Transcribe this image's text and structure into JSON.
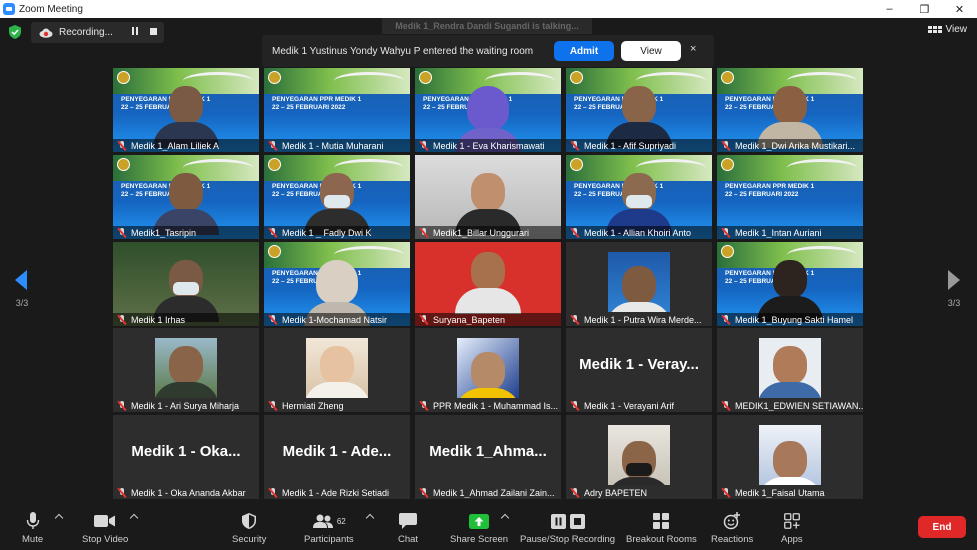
{
  "window": {
    "title": "Zoom Meeting",
    "minimize": "–",
    "maximize": "❐",
    "close": "✕"
  },
  "topbar": {
    "recording_label": "Recording...",
    "talking_banner": "Medik 1_Rendra Dandi Sugandi is talking...",
    "view_label": "View"
  },
  "notification": {
    "message": "Medik 1   Yustinus Yondy Wahyu P entered the waiting room",
    "admit_label": "Admit",
    "view_label": "View",
    "close_label": "×"
  },
  "pager": {
    "left_page": "3/3",
    "right_page": "3/3"
  },
  "banner": {
    "line1": "PENYEGARAN PPR MEDIK 1",
    "line2": "22 – 25 FEBRUARI 2022"
  },
  "participants": [
    {
      "name": "Medik 1_Alam Liliek A"
    },
    {
      "name": "Medik 1 - Mutia Muharani"
    },
    {
      "name": "Medik 1 - Eva Kharismawati"
    },
    {
      "name": "Medik 1 - Afif Supriyadi"
    },
    {
      "name": "Medik 1_Dwi Arika Mustikari..."
    },
    {
      "name": "Medik1_Tasripin"
    },
    {
      "name": "Medik 1 _ Fadly Dwi K"
    },
    {
      "name": "Medik1_Billar Unggurari"
    },
    {
      "name": "Medik 1 - Allian Khoiri Anto"
    },
    {
      "name": "Medik 1_Intan Auriani"
    },
    {
      "name": "Medik 1 Irhas"
    },
    {
      "name": "Medik 1-Mochamad Natsir"
    },
    {
      "name": "Suryana_Bapeten"
    },
    {
      "name": "Medik 1 - Putra Wira Merde..."
    },
    {
      "name": "Medik 1_Buyung Sakti Hamel"
    },
    {
      "name": "Medik 1 - Ari Surya Miharja"
    },
    {
      "name": "Hermiati Zheng"
    },
    {
      "name": "PPR Medik 1 - Muhammad Is..."
    },
    {
      "name": "Medik 1 - Verayani Arif",
      "big": "Medik 1 - Veray..."
    },
    {
      "name": "MEDIK1_EDWIEN SETIAWAN..."
    },
    {
      "name": "Medik 1 - Oka Ananda Akbar",
      "big": "Medik 1 - Oka..."
    },
    {
      "name": "Medik 1 - Ade Rizki Setiadi",
      "big": "Medik 1 - Ade..."
    },
    {
      "name": "Medik 1_Ahmad Zailani Zain...",
      "big": "Medik 1_Ahma..."
    },
    {
      "name": "Adry BAPETEN"
    },
    {
      "name": "Medik 1_Faisal Utama"
    }
  ],
  "toolbar": {
    "mute": "Mute",
    "stop_video": "Stop Video",
    "security": "Security",
    "participants": "Participants",
    "participants_count": "62",
    "chat": "Chat",
    "share_screen": "Share Screen",
    "pause_stop_recording": "Pause/Stop Recording",
    "breakout_rooms": "Breakout Rooms",
    "reactions": "Reactions",
    "apps": "Apps",
    "end": "End"
  },
  "colors": {
    "accent": "#2d8cff",
    "admit": "#0e72ed",
    "end": "#e02828",
    "share": "#1fbf3a",
    "muted": "#e03333"
  }
}
